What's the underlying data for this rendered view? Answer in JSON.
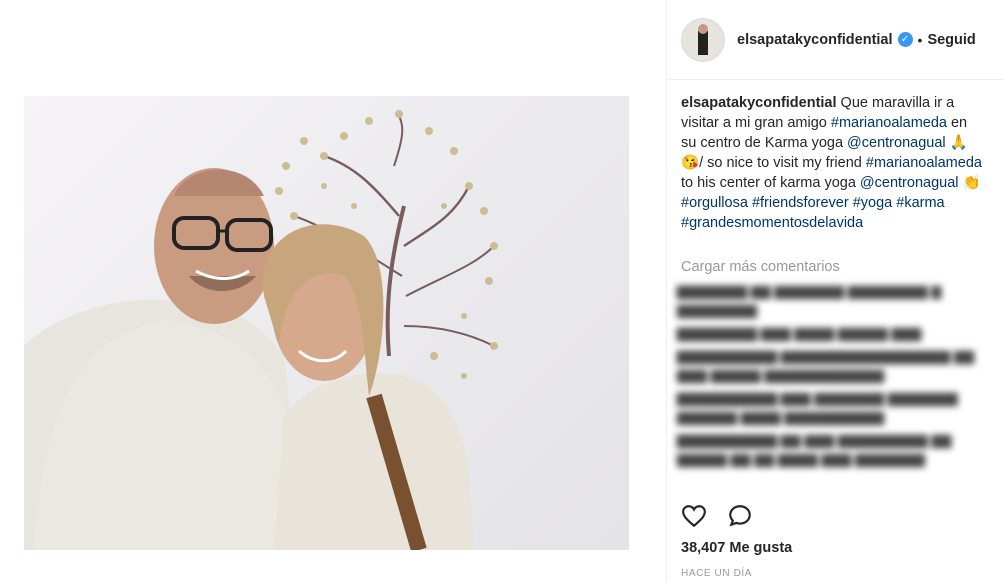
{
  "post": {
    "username": "elsapatakyconfidential",
    "follow_separator": "•",
    "follow_label": "Seguid",
    "caption": {
      "username": "elsapatakyconfidential",
      "text_1": " Que maravilla ir a visitar a mi gran amigo ",
      "tag_1": "#marianoalameda",
      "text_2": " en su centro de Karma yoga ",
      "tag_2": "@centronagual",
      "emoji_1": " 🙏😘",
      "text_3": "/ so nice to visit my friend ",
      "tag_3": "#marianoalameda",
      "text_4": " to his center of karma yoga ",
      "tag_4": "@centronagual",
      "emoji_2": " 👏",
      "text_5": " ",
      "tag_5": "#orgullosa",
      "tag_6": "#friendsforever",
      "tag_7": "#yoga",
      "tag_8": "#karma",
      "tag_9": "#grandesmomentosdelavida"
    },
    "load_more": "Cargar más comentarios",
    "likes": "38,407 Me gusta",
    "timestamp": "HACE UN DÍA"
  },
  "icons": {
    "heart": "heart-icon",
    "comment": "comment-icon",
    "verified": "verified-badge-icon"
  },
  "colors": {
    "hashtag": "#003569",
    "verified": "#3897f0",
    "muted": "#999999"
  }
}
